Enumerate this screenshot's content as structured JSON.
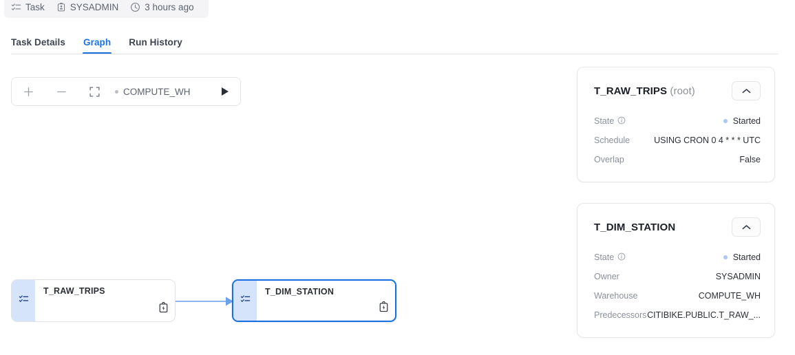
{
  "header": {
    "meta": [
      {
        "icon": "task-icon",
        "label": "Task"
      },
      {
        "icon": "badge-icon",
        "label": "SYSADMIN"
      },
      {
        "icon": "clock-icon",
        "label": "3 hours ago"
      }
    ]
  },
  "tabs": [
    {
      "label": "Task Details",
      "active": false
    },
    {
      "label": "Graph",
      "active": true
    },
    {
      "label": "Run History",
      "active": false
    }
  ],
  "toolbar": {
    "zoom_in_label": "+",
    "zoom_out_label": "—",
    "fit_label": "fit-to-screen",
    "warehouse": "COMPUTE_WH",
    "run_label": "Run"
  },
  "graph": {
    "nodes": [
      {
        "title": "T_RAW_TRIPS",
        "selected": false
      },
      {
        "title": "T_DIM_STATION",
        "selected": true
      }
    ],
    "edge_label": ""
  },
  "panels": [
    {
      "title": "T_RAW_TRIPS",
      "suffix": "(root)",
      "rows": [
        {
          "label": "State",
          "info": true,
          "value": "Started",
          "dot": true
        },
        {
          "label": "Schedule",
          "info": false,
          "value": "USING CRON 0 4 * * * UTC",
          "dot": false
        },
        {
          "label": "Overlap",
          "info": false,
          "value": "False",
          "dot": false
        }
      ]
    },
    {
      "title": "T_DIM_STATION",
      "suffix": "",
      "rows": [
        {
          "label": "State",
          "info": true,
          "value": "Started",
          "dot": true
        },
        {
          "label": "Owner",
          "info": false,
          "value": "SYSADMIN",
          "dot": false
        },
        {
          "label": "Warehouse",
          "info": false,
          "value": "COMPUTE_WH",
          "dot": false
        },
        {
          "label": "Predecessors",
          "info": false,
          "value": "CITIBIKE.PUBLIC.T_RAW_...",
          "dot": false
        }
      ]
    }
  ],
  "colors": {
    "accent": "#1a6fe0",
    "strip": "#d6e4fb",
    "state_dot": "#aec6f5",
    "edge": "#8cb4f0"
  }
}
